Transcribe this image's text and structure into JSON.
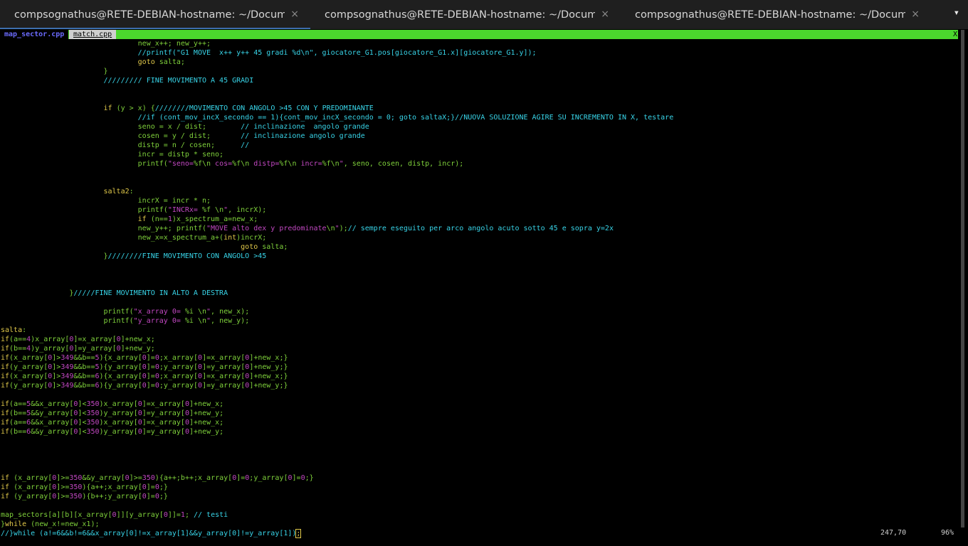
{
  "window": {
    "tabs": [
      {
        "title": "compsognathus@RETE-DEBIAN-hostname: ~/Docume…",
        "close": "×"
      },
      {
        "title": "compsognathus@RETE-DEBIAN-hostname: ~/Docume…",
        "close": "×"
      },
      {
        "title": "compsognathus@RETE-DEBIAN-hostname: ~/Docume…",
        "close": "×"
      }
    ],
    "menu_icon": "▾"
  },
  "vim": {
    "buffers": [
      "map_sector.cpp",
      "match.cpp"
    ],
    "tabline_close": "X",
    "ruler_position": "247,70",
    "ruler_percent": "96%"
  },
  "colors": {
    "tabline_bg": "#4bd72d",
    "comment": "#38d4e8",
    "keyword": "#e0c84a",
    "number_string": "#c248c2",
    "code": "#7fd13b"
  },
  "code_lines": [
    [
      [
        "                                new_x++; new_y++;",
        "code"
      ]
    ],
    [
      [
        "                                //printf(\"G1 MOVE  x++ y++ 45 gradi %d\\n\", giocatore_G1.pos[giocatore_G1.x][giocatore_G1.y]);",
        "cmt"
      ]
    ],
    [
      [
        "                                ",
        "code"
      ],
      [
        "goto",
        "kw"
      ],
      [
        " salta;",
        "code"
      ]
    ],
    [
      [
        "                        }",
        "code"
      ]
    ],
    [
      [
        "                        ///////// FINE MOVIMENTO A 45 GRADI",
        "cmt"
      ]
    ],
    [
      [
        "",
        "code"
      ]
    ],
    [
      [
        "",
        "code"
      ]
    ],
    [
      [
        "                        ",
        "code"
      ],
      [
        "if",
        "kw"
      ],
      [
        " (y > x) {",
        "code"
      ],
      [
        "////////MOVIMENTO CON ANGOLO >45 CON Y PREDOMINANTE",
        "cmt"
      ]
    ],
    [
      [
        "                                //if (cont_mov_incX_secondo == 1){cont_mov_incX_secondo = 0; goto saltaX;}//NUOVA SOLUZIONE AGIRE SU INCREMENTO IN X, testare",
        "cmt"
      ]
    ],
    [
      [
        "                                seno = x / dist;        ",
        "code"
      ],
      [
        "// inclinazione  angolo grande",
        "cmt"
      ]
    ],
    [
      [
        "                                cosen = y / dist;       ",
        "code"
      ],
      [
        "// inclinazione angolo grande",
        "cmt"
      ]
    ],
    [
      [
        "                                distp = n / cosen;      ",
        "code"
      ],
      [
        "//",
        "cmt"
      ]
    ],
    [
      [
        "                                incr = distp * seno;",
        "code"
      ]
    ],
    [
      [
        "                                printf(",
        "code"
      ],
      [
        "\"seno=",
        "str"
      ],
      [
        "%f\\n",
        "code"
      ],
      [
        " cos=",
        "str"
      ],
      [
        "%f\\n",
        "code"
      ],
      [
        " distp=",
        "str"
      ],
      [
        "%f\\n",
        "code"
      ],
      [
        " incr=",
        "str"
      ],
      [
        "%f\\n",
        "code"
      ],
      [
        "\"",
        "str"
      ],
      [
        ", seno, cosen, distp, incr);",
        "code"
      ]
    ],
    [
      [
        "",
        "code"
      ]
    ],
    [
      [
        "",
        "code"
      ]
    ],
    [
      [
        "                        ",
        "code"
      ],
      [
        "salta2",
        "kw"
      ],
      [
        ":",
        "code"
      ]
    ],
    [
      [
        "                                incrX = incr * n;",
        "code"
      ]
    ],
    [
      [
        "                                printf(",
        "code"
      ],
      [
        "\"INCRx= ",
        "str"
      ],
      [
        "%f \\n",
        "code"
      ],
      [
        "\"",
        "str"
      ],
      [
        ", incrX);",
        "code"
      ]
    ],
    [
      [
        "                                ",
        "code"
      ],
      [
        "if",
        "kw"
      ],
      [
        " (n==",
        "code"
      ],
      [
        "1",
        "num"
      ],
      [
        ")x_spectrum_a=new_x;",
        "code"
      ]
    ],
    [
      [
        "                                new_y++; printf(",
        "code"
      ],
      [
        "\"MOVE alto dex y predominate",
        "str"
      ],
      [
        "\\n",
        "code"
      ],
      [
        "\"",
        "str"
      ],
      [
        ");",
        "code"
      ],
      [
        "// sempre eseguito per arco angolo acuto sotto 45 e sopra y=2x",
        "cmt"
      ]
    ],
    [
      [
        "                                new_x=x_spectrum_a+(",
        "code"
      ],
      [
        "int",
        "kw"
      ],
      [
        ")incrX;",
        "code"
      ]
    ],
    [
      [
        "                                                        ",
        "code"
      ],
      [
        "goto",
        "kw"
      ],
      [
        " salta;",
        "code"
      ]
    ],
    [
      [
        "                        }",
        "code"
      ],
      [
        "////////FINE MOVIMENTO CON ANGOLO >45",
        "cmt"
      ]
    ],
    [
      [
        "",
        "code"
      ]
    ],
    [
      [
        "",
        "code"
      ]
    ],
    [
      [
        "",
        "code"
      ]
    ],
    [
      [
        "                }",
        "code"
      ],
      [
        "/////FINE MOVIMENTO IN ALTO A DESTRA",
        "cmt"
      ]
    ],
    [
      [
        "",
        "code"
      ]
    ],
    [
      [
        "                        printf(",
        "code"
      ],
      [
        "\"x_array 0= ",
        "str"
      ],
      [
        "%i \\n",
        "code"
      ],
      [
        "\"",
        "str"
      ],
      [
        ", new_x);",
        "code"
      ]
    ],
    [
      [
        "                        printf(",
        "code"
      ],
      [
        "\"y_array 0= ",
        "str"
      ],
      [
        "%i \\n",
        "code"
      ],
      [
        "\"",
        "str"
      ],
      [
        ", new_y);",
        "code"
      ]
    ],
    [
      [
        "salta",
        "kw"
      ],
      [
        ":",
        "code"
      ]
    ],
    [
      [
        "if",
        "kw"
      ],
      [
        "(a==",
        "code"
      ],
      [
        "4",
        "num"
      ],
      [
        ")x_array[",
        "code"
      ],
      [
        "0",
        "num"
      ],
      [
        "]=x_array[",
        "code"
      ],
      [
        "0",
        "num"
      ],
      [
        "]+new_x;",
        "code"
      ]
    ],
    [
      [
        "if",
        "kw"
      ],
      [
        "(b==",
        "code"
      ],
      [
        "4",
        "num"
      ],
      [
        ")y_array[",
        "code"
      ],
      [
        "0",
        "num"
      ],
      [
        "]=y_array[",
        "code"
      ],
      [
        "0",
        "num"
      ],
      [
        "]+new_y;",
        "code"
      ]
    ],
    [
      [
        "if",
        "kw"
      ],
      [
        "(x_array[",
        "code"
      ],
      [
        "0",
        "num"
      ],
      [
        "]>",
        "code"
      ],
      [
        "349",
        "num"
      ],
      [
        "&&b==",
        "code"
      ],
      [
        "5",
        "num"
      ],
      [
        ")",
        "code"
      ],
      [
        "{x_array[",
        "code"
      ],
      [
        "0",
        "num"
      ],
      [
        "]=",
        "code"
      ],
      [
        "0",
        "num"
      ],
      [
        ";x_array[",
        "code"
      ],
      [
        "0",
        "num"
      ],
      [
        "]=x_array[",
        "code"
      ],
      [
        "0",
        "num"
      ],
      [
        "]+new_x;}",
        "code"
      ]
    ],
    [
      [
        "if",
        "kw"
      ],
      [
        "(y_array[",
        "code"
      ],
      [
        "0",
        "num"
      ],
      [
        "]>",
        "code"
      ],
      [
        "349",
        "num"
      ],
      [
        "&&b==",
        "code"
      ],
      [
        "5",
        "num"
      ],
      [
        ")",
        "code"
      ],
      [
        "{y_array[",
        "code"
      ],
      [
        "0",
        "num"
      ],
      [
        "]=",
        "code"
      ],
      [
        "0",
        "num"
      ],
      [
        ";y_array[",
        "code"
      ],
      [
        "0",
        "num"
      ],
      [
        "]=y_array[",
        "code"
      ],
      [
        "0",
        "num"
      ],
      [
        "]+new_y;}",
        "code"
      ]
    ],
    [
      [
        "if",
        "kw"
      ],
      [
        "(x_array[",
        "code"
      ],
      [
        "0",
        "num"
      ],
      [
        "]>",
        "code"
      ],
      [
        "349",
        "num"
      ],
      [
        "&&b==",
        "code"
      ],
      [
        "6",
        "num"
      ],
      [
        ")",
        "code"
      ],
      [
        "{x_array[",
        "code"
      ],
      [
        "0",
        "num"
      ],
      [
        "]=",
        "code"
      ],
      [
        "0",
        "num"
      ],
      [
        ";x_array[",
        "code"
      ],
      [
        "0",
        "num"
      ],
      [
        "]=x_array[",
        "code"
      ],
      [
        "0",
        "num"
      ],
      [
        "]+new_x;}",
        "code"
      ]
    ],
    [
      [
        "if",
        "kw"
      ],
      [
        "(y_array[",
        "code"
      ],
      [
        "0",
        "num"
      ],
      [
        "]>",
        "code"
      ],
      [
        "349",
        "num"
      ],
      [
        "&&b==",
        "code"
      ],
      [
        "6",
        "num"
      ],
      [
        ")",
        "code"
      ],
      [
        "{y_array[",
        "code"
      ],
      [
        "0",
        "num"
      ],
      [
        "]=",
        "code"
      ],
      [
        "0",
        "num"
      ],
      [
        ";y_array[",
        "code"
      ],
      [
        "0",
        "num"
      ],
      [
        "]=y_array[",
        "code"
      ],
      [
        "0",
        "num"
      ],
      [
        "]+new_y;}",
        "code"
      ]
    ],
    [
      [
        "",
        "code"
      ]
    ],
    [
      [
        "if",
        "kw"
      ],
      [
        "(a==",
        "code"
      ],
      [
        "5",
        "num"
      ],
      [
        "&&x_array[",
        "code"
      ],
      [
        "0",
        "num"
      ],
      [
        "]<",
        "code"
      ],
      [
        "350",
        "num"
      ],
      [
        ")x_array[",
        "code"
      ],
      [
        "0",
        "num"
      ],
      [
        "]=x_array[",
        "code"
      ],
      [
        "0",
        "num"
      ],
      [
        "]+new_x;",
        "code"
      ]
    ],
    [
      [
        "if",
        "kw"
      ],
      [
        "(b==",
        "code"
      ],
      [
        "5",
        "num"
      ],
      [
        "&&y_array[",
        "code"
      ],
      [
        "0",
        "num"
      ],
      [
        "]<",
        "code"
      ],
      [
        "350",
        "num"
      ],
      [
        ")y_array[",
        "code"
      ],
      [
        "0",
        "num"
      ],
      [
        "]=y_array[",
        "code"
      ],
      [
        "0",
        "num"
      ],
      [
        "]+new_y;",
        "code"
      ]
    ],
    [
      [
        "if",
        "kw"
      ],
      [
        "(a==",
        "code"
      ],
      [
        "6",
        "num"
      ],
      [
        "&&x_array[",
        "code"
      ],
      [
        "0",
        "num"
      ],
      [
        "]<",
        "code"
      ],
      [
        "350",
        "num"
      ],
      [
        ")x_array[",
        "code"
      ],
      [
        "0",
        "num"
      ],
      [
        "]=x_array[",
        "code"
      ],
      [
        "0",
        "num"
      ],
      [
        "]+new_x;",
        "code"
      ]
    ],
    [
      [
        "if",
        "kw"
      ],
      [
        "(b==",
        "code"
      ],
      [
        "6",
        "num"
      ],
      [
        "&&y_array[",
        "code"
      ],
      [
        "0",
        "num"
      ],
      [
        "]<",
        "code"
      ],
      [
        "350",
        "num"
      ],
      [
        ")y_array[",
        "code"
      ],
      [
        "0",
        "num"
      ],
      [
        "]=y_array[",
        "code"
      ],
      [
        "0",
        "num"
      ],
      [
        "]+new_y;",
        "code"
      ]
    ],
    [
      [
        "",
        "code"
      ]
    ],
    [
      [
        "",
        "code"
      ]
    ],
    [
      [
        "",
        "code"
      ]
    ],
    [
      [
        "",
        "code"
      ]
    ],
    [
      [
        "if",
        "kw"
      ],
      [
        " (x_array[",
        "code"
      ],
      [
        "0",
        "num"
      ],
      [
        "]>=",
        "code"
      ],
      [
        "350",
        "num"
      ],
      [
        "&&y_array[",
        "code"
      ],
      [
        "0",
        "num"
      ],
      [
        "]>=",
        "code"
      ],
      [
        "350",
        "num"
      ],
      [
        ")",
        "code"
      ],
      [
        "{a++;b++;x_array[",
        "code"
      ],
      [
        "0",
        "num"
      ],
      [
        "]=",
        "code"
      ],
      [
        "0",
        "num"
      ],
      [
        ";y_array[",
        "code"
      ],
      [
        "0",
        "num"
      ],
      [
        "]=",
        "code"
      ],
      [
        "0",
        "num"
      ],
      [
        ";}",
        "code"
      ]
    ],
    [
      [
        "if",
        "kw"
      ],
      [
        " (x_array[",
        "code"
      ],
      [
        "0",
        "num"
      ],
      [
        "]>=",
        "code"
      ],
      [
        "350",
        "num"
      ],
      [
        ")",
        "code"
      ],
      [
        "{a++;x_array[",
        "code"
      ],
      [
        "0",
        "num"
      ],
      [
        "]=",
        "code"
      ],
      [
        "0",
        "num"
      ],
      [
        ";}",
        "code"
      ]
    ],
    [
      [
        "if",
        "kw"
      ],
      [
        " (y_array[",
        "code"
      ],
      [
        "0",
        "num"
      ],
      [
        "]>=",
        "code"
      ],
      [
        "350",
        "num"
      ],
      [
        ")",
        "code"
      ],
      [
        "{b++;y_array[",
        "code"
      ],
      [
        "0",
        "num"
      ],
      [
        "]=",
        "code"
      ],
      [
        "0",
        "num"
      ],
      [
        ";}",
        "code"
      ]
    ],
    [
      [
        "",
        "code"
      ]
    ],
    [
      [
        "map_sectors[a][b][x_array[",
        "code"
      ],
      [
        "0",
        "num"
      ],
      [
        "]][y_array[",
        "code"
      ],
      [
        "0",
        "num"
      ],
      [
        "]]=",
        "code"
      ],
      [
        "1",
        "num"
      ],
      [
        "; ",
        "code"
      ],
      [
        "// testi",
        "cmt"
      ]
    ],
    [
      [
        "}",
        "code"
      ],
      [
        "while",
        "kw"
      ],
      [
        " (new_x!=new_x1);",
        "code"
      ]
    ],
    [
      [
        "//}while (a!=6&&b!=6&&x_array[0]!=x_array[1]&&y_array[0]!=y_array[1])",
        "cmt"
      ],
      [
        ";",
        "cur"
      ]
    ]
  ]
}
